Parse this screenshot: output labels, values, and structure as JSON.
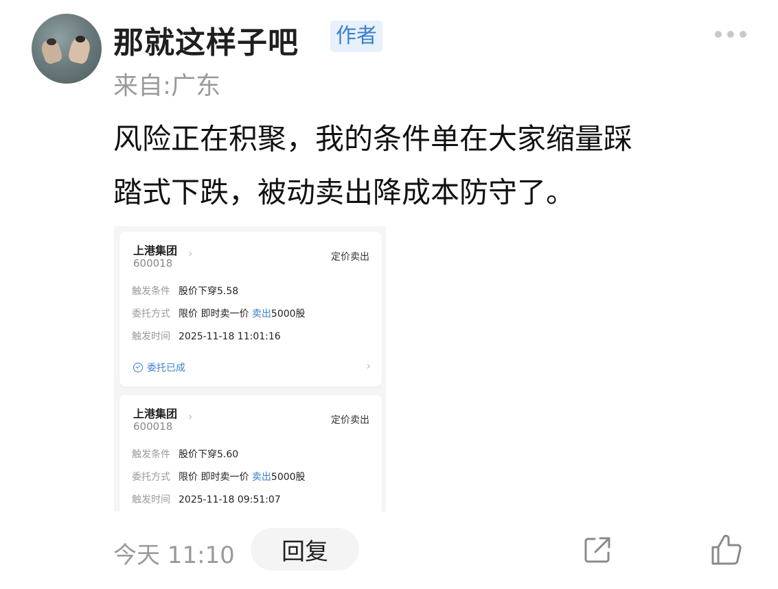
{
  "post": {
    "username": "那就这样子吧",
    "author_badge": "作者",
    "location": "来自:广东",
    "text_lines": [
      "风险正在积聚，我的条件单在大家缩量踩",
      "踏式下跌，被动卖出降成本防守了。"
    ],
    "time": "今天 11:10",
    "reply_label": "回复"
  },
  "screenshot": {
    "cards": [
      {
        "stock_name": "上港集团",
        "stock_code": "600018",
        "order_type": "定价卖出",
        "trigger_condition_label": "触发条件",
        "trigger_condition": "股价下穿5.58",
        "order_method_label": "委托方式",
        "order_method_prefix": "限价 即时卖一价 ",
        "order_method_action": "卖出",
        "order_method_qty": "5000股",
        "trigger_time_label": "触发时间",
        "trigger_time": "2025-11-18 11:01:16",
        "status": "委托已成"
      },
      {
        "stock_name": "上港集团",
        "stock_code": "600018",
        "order_type": "定价卖出",
        "trigger_condition_label": "触发条件",
        "trigger_condition": "股价下穿5.60",
        "order_method_label": "委托方式",
        "order_method_prefix": "限价 即时卖一价 ",
        "order_method_action": "卖出",
        "order_method_qty": "5000股",
        "trigger_time_label": "触发时间",
        "trigger_time": "2025-11-18 09:51:07"
      }
    ]
  },
  "icons": {
    "more": "more-dots-icon",
    "share": "share-icon",
    "like": "thumbs-up-icon"
  },
  "colors": {
    "accent": "#3b7fc8",
    "badge_bg": "#e6f1fb",
    "muted": "#9a9a9a"
  }
}
